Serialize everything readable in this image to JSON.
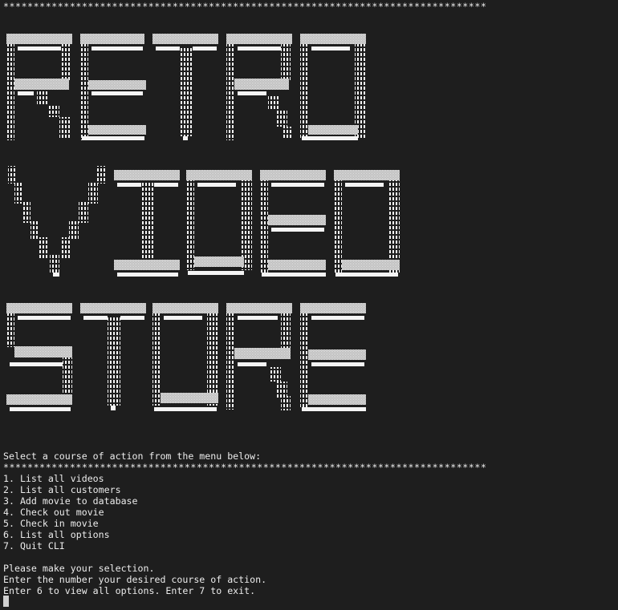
{
  "separator": "********************************************************************************",
  "banner": {
    "words": [
      "RETRO",
      "VIDEO",
      "STORE"
    ],
    "fg_color": "#f4f4f4",
    "shade_color": "#a8a8a8",
    "bg_color": "#1e1e1e"
  },
  "prompt": "Select a course of action from the menu below:",
  "menu": [
    "1. List all videos",
    "2. List all customers",
    "3. Add movie to database",
    "4. Check out movie",
    "5. Check in movie",
    "6. List all options",
    "7. Quit CLI"
  ],
  "instructions": [
    "Please make your selection.",
    "Enter the number your desired course of action.",
    "Enter 6 to view all options. Enter 7 to exit."
  ],
  "colors": {
    "background": "#1e1e1e",
    "text": "#ececec",
    "cursor": "#cfcfcf"
  }
}
